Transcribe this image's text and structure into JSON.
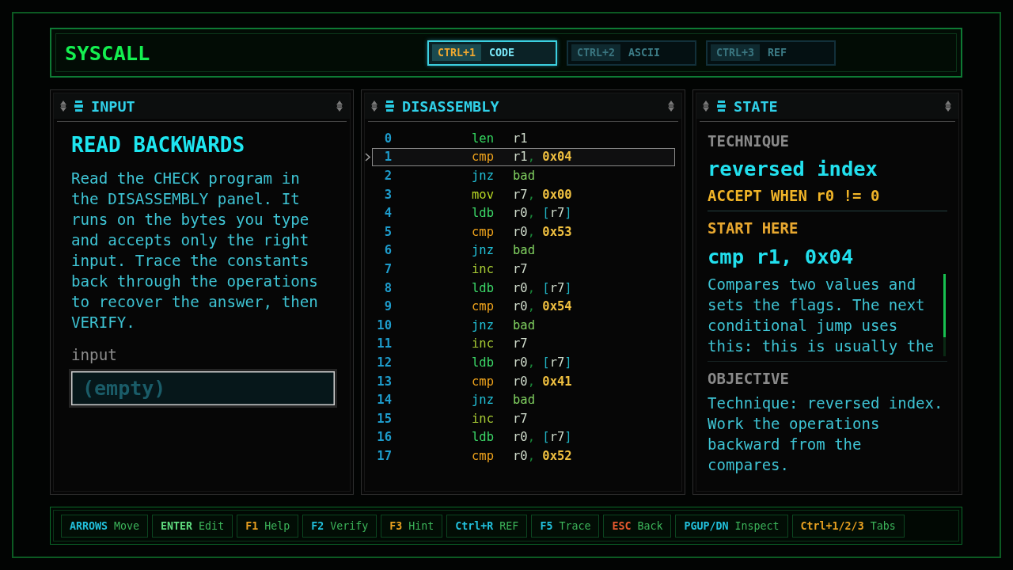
{
  "header": {
    "title": "SYSCALL",
    "tabs": [
      {
        "key": "CTRL+1",
        "label": "CODE",
        "selected": true
      },
      {
        "key": "CTRL+2",
        "label": "ASCII",
        "selected": false
      },
      {
        "key": "CTRL+3",
        "label": "REF",
        "selected": false
      }
    ]
  },
  "panels": {
    "input": {
      "title": "INPUT",
      "heading": "READ BACKWARDS",
      "body": "Read the CHECK program in the DISASSEMBLY panel. It runs on the bytes you type and accepts only the right input. Trace the constants back through the operations to recover the answer, then VERIFY.",
      "field": {
        "label": "input",
        "placeholder": "(empty)"
      }
    },
    "disassembly": {
      "title": "DISASSEMBLY",
      "rows": [
        {
          "index": "0",
          "mnemonic": "len",
          "kind": "length",
          "selected": false,
          "operands": [
            {
              "text": "r1",
              "kind": "register"
            }
          ]
        },
        {
          "index": "1",
          "mnemonic": "cmp",
          "kind": "compare",
          "selected": true,
          "operands": [
            {
              "text": "r1",
              "kind": "register"
            },
            {
              "text": ",",
              "kind": "separator"
            },
            {
              "text": "0x04",
              "kind": "immediate"
            }
          ]
        },
        {
          "index": "2",
          "mnemonic": "jnz",
          "kind": "jump",
          "selected": false,
          "operands": [
            {
              "text": "bad",
              "kind": "label"
            }
          ]
        },
        {
          "index": "3",
          "mnemonic": "mov",
          "kind": "move",
          "selected": false,
          "operands": [
            {
              "text": "r7",
              "kind": "register"
            },
            {
              "text": ",",
              "kind": "separator"
            },
            {
              "text": "0x00",
              "kind": "immediate"
            }
          ]
        },
        {
          "index": "4",
          "mnemonic": "ldb",
          "kind": "load",
          "selected": false,
          "operands": [
            {
              "text": "r0",
              "kind": "register"
            },
            {
              "text": ",",
              "kind": "separator"
            },
            {
              "text": "[",
              "kind": "bracket"
            },
            {
              "text": "r7",
              "kind": "register"
            },
            {
              "text": "]",
              "kind": "bracket"
            }
          ]
        },
        {
          "index": "5",
          "mnemonic": "cmp",
          "kind": "compare",
          "selected": false,
          "operands": [
            {
              "text": "r0",
              "kind": "register"
            },
            {
              "text": ",",
              "kind": "separator"
            },
            {
              "text": "0x53",
              "kind": "immediate"
            }
          ]
        },
        {
          "index": "6",
          "mnemonic": "jnz",
          "kind": "jump",
          "selected": false,
          "operands": [
            {
              "text": "bad",
              "kind": "label"
            }
          ]
        },
        {
          "index": "7",
          "mnemonic": "inc",
          "kind": "increment",
          "selected": false,
          "operands": [
            {
              "text": "r7",
              "kind": "register"
            }
          ]
        },
        {
          "index": "8",
          "mnemonic": "ldb",
          "kind": "load",
          "selected": false,
          "operands": [
            {
              "text": "r0",
              "kind": "register"
            },
            {
              "text": ",",
              "kind": "separator"
            },
            {
              "text": "[",
              "kind": "bracket"
            },
            {
              "text": "r7",
              "kind": "register"
            },
            {
              "text": "]",
              "kind": "bracket"
            }
          ]
        },
        {
          "index": "9",
          "mnemonic": "cmp",
          "kind": "compare",
          "selected": false,
          "operands": [
            {
              "text": "r0",
              "kind": "register"
            },
            {
              "text": ",",
              "kind": "separator"
            },
            {
              "text": "0x54",
              "kind": "immediate"
            }
          ]
        },
        {
          "index": "10",
          "mnemonic": "jnz",
          "kind": "jump",
          "selected": false,
          "operands": [
            {
              "text": "bad",
              "kind": "label"
            }
          ]
        },
        {
          "index": "11",
          "mnemonic": "inc",
          "kind": "increment",
          "selected": false,
          "operands": [
            {
              "text": "r7",
              "kind": "register"
            }
          ]
        },
        {
          "index": "12",
          "mnemonic": "ldb",
          "kind": "load",
          "selected": false,
          "operands": [
            {
              "text": "r0",
              "kind": "register"
            },
            {
              "text": ",",
              "kind": "separator"
            },
            {
              "text": "[",
              "kind": "bracket"
            },
            {
              "text": "r7",
              "kind": "register"
            },
            {
              "text": "]",
              "kind": "bracket"
            }
          ]
        },
        {
          "index": "13",
          "mnemonic": "cmp",
          "kind": "compare",
          "selected": false,
          "operands": [
            {
              "text": "r0",
              "kind": "register"
            },
            {
              "text": ",",
              "kind": "separator"
            },
            {
              "text": "0x41",
              "kind": "immediate"
            }
          ]
        },
        {
          "index": "14",
          "mnemonic": "jnz",
          "kind": "jump",
          "selected": false,
          "operands": [
            {
              "text": "bad",
              "kind": "label"
            }
          ]
        },
        {
          "index": "15",
          "mnemonic": "inc",
          "kind": "increment",
          "selected": false,
          "operands": [
            {
              "text": "r7",
              "kind": "register"
            }
          ]
        },
        {
          "index": "16",
          "mnemonic": "ldb",
          "kind": "load",
          "selected": false,
          "operands": [
            {
              "text": "r0",
              "kind": "register"
            },
            {
              "text": ",",
              "kind": "separator"
            },
            {
              "text": "[",
              "kind": "bracket"
            },
            {
              "text": "r7",
              "kind": "register"
            },
            {
              "text": "]",
              "kind": "bracket"
            }
          ]
        },
        {
          "index": "17",
          "mnemonic": "cmp",
          "kind": "compare",
          "selected": false,
          "operands": [
            {
              "text": "r0",
              "kind": "register"
            },
            {
              "text": ",",
              "kind": "separator"
            },
            {
              "text": "0x52",
              "kind": "immediate"
            }
          ]
        }
      ]
    },
    "state": {
      "title": "STATE",
      "technique": {
        "label": "TECHNIQUE",
        "value": "reversed index"
      },
      "accept": "ACCEPT WHEN r0 != 0",
      "start": {
        "label": "START HERE",
        "instruction": "cmp r1, 0x04",
        "description": "Compares two values and sets the flags. The next conditional jump uses this: this is usually the"
      },
      "objective": {
        "label": "OBJECTIVE",
        "text": "Technique: reversed index. Work the operations backward from the compares."
      }
    }
  },
  "footer": {
    "hints": [
      {
        "key": "ARROWS",
        "action": "Move",
        "color": "#22c0dc"
      },
      {
        "key": "ENTER",
        "action": "Edit",
        "color": "#60dd80"
      },
      {
        "key": "F1",
        "action": "Help",
        "color": "#e8a020"
      },
      {
        "key": "F2",
        "action": "Verify",
        "color": "#22c0dc"
      },
      {
        "key": "F3",
        "action": "Hint",
        "color": "#e8a020"
      },
      {
        "key": "Ctrl+R",
        "action": "REF",
        "color": "#22c0dc"
      },
      {
        "key": "F5",
        "action": "Trace",
        "color": "#22c0dc"
      },
      {
        "key": "ESC",
        "action": "Back",
        "color": "#e85a30"
      },
      {
        "key": "PGUP/DN",
        "action": "Inspect",
        "color": "#22c0dc"
      },
      {
        "key": "Ctrl+1/2/3",
        "action": "Tabs",
        "color": "#e8a020"
      }
    ]
  }
}
